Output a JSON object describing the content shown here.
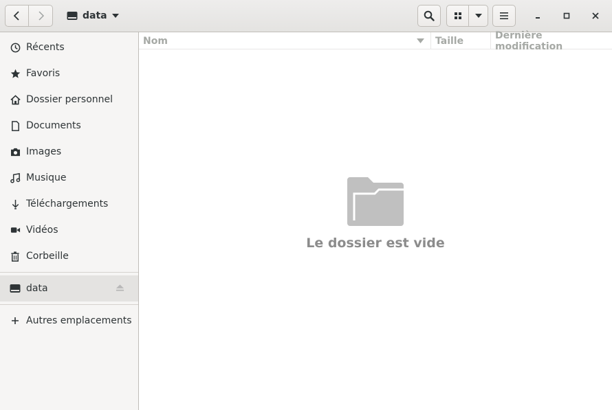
{
  "header": {
    "path_label": "data",
    "icons": {
      "back": "chevron-left-icon",
      "forward": "chevron-right-icon",
      "drive": "drive-icon",
      "path_menu": "chevron-down-icon",
      "search": "search-icon",
      "view_grid": "grid-icon",
      "view_menu": "chevron-down-icon",
      "menu": "hamburger-icon",
      "minimize": "minimize-icon",
      "maximize": "maximize-icon",
      "close": "close-icon"
    }
  },
  "sidebar": {
    "items": [
      {
        "label": "Récents",
        "icon": "clock-icon"
      },
      {
        "label": "Favoris",
        "icon": "star-icon"
      },
      {
        "label": "Dossier personnel",
        "icon": "home-icon"
      },
      {
        "label": "Documents",
        "icon": "document-icon"
      },
      {
        "label": "Images",
        "icon": "camera-icon"
      },
      {
        "label": "Musique",
        "icon": "music-icon"
      },
      {
        "label": "Téléchargements",
        "icon": "download-icon"
      },
      {
        "label": "Vidéos",
        "icon": "video-icon"
      },
      {
        "label": "Corbeille",
        "icon": "trash-icon"
      }
    ],
    "devices": [
      {
        "label": "data",
        "icon": "drive-icon",
        "eject_icon": "eject-icon"
      }
    ],
    "other": {
      "label": "Autres emplacements",
      "icon": "plus-icon"
    }
  },
  "main": {
    "columns": {
      "name": "Nom",
      "size": "Taille",
      "modified": "Dernière modification"
    },
    "empty_message": "Le dossier est vide",
    "empty_icon": "folder-icon"
  },
  "colors": {
    "header_bg": "#e8e7e6",
    "sidebar_bg": "#f6f5f4",
    "active_item_bg": "#e4e3e1",
    "muted_text": "#8c8c8c",
    "folder_icon": "#c0c0c0"
  }
}
